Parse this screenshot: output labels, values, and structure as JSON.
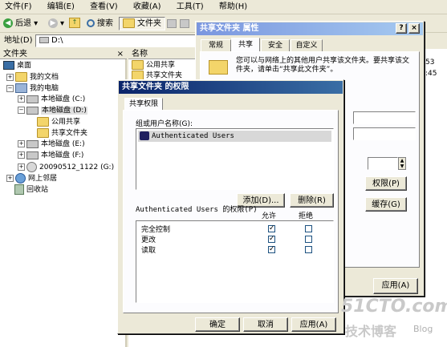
{
  "menu": [
    "文件(F)",
    "编辑(E)",
    "查看(V)",
    "收藏(A)",
    "工具(T)",
    "帮助(H)"
  ],
  "toolbar": {
    "back": "后退",
    "search": "搜索",
    "folders": "文件夹"
  },
  "address": {
    "label": "地址(D)",
    "value": "D:\\"
  },
  "tree": {
    "header": "文件夹",
    "items": [
      "桌面",
      "我的文档",
      "我的电脑",
      "本地磁盘 (C:)",
      "本地磁盘 (D:)",
      "公用共享",
      "共享文件夹",
      "本地磁盘 (E:)",
      "本地磁盘 (F:)",
      "20090512_1122 (G:)",
      "网上邻居",
      "回收站"
    ]
  },
  "list": {
    "column": "名称",
    "items": [
      "公用共享",
      "共享文件夹"
    ],
    "side_text": [
      "53",
      ":45"
    ]
  },
  "props": {
    "title": "共享文件夹 属性",
    "tabs": [
      "常规",
      "共享",
      "安全",
      "自定义"
    ],
    "description": "您可以与网络上的其他用户共享该文件夹。要共享该文件夹，请单击“共享此文件夹”。",
    "permissions_btn": "权限(P)",
    "cache_btn": "缓存(G)",
    "apply_btn": "应用(A)"
  },
  "perm": {
    "title": "共享文件夹 的权限",
    "tab": "共享权限",
    "group_label": "组或用户名称(G):",
    "users": [
      "Authenticated Users"
    ],
    "add_btn": "添加(D)...",
    "remove_btn": "删除(R)",
    "perm_label": "Authenticated Users 的权限(P)",
    "allow_header": "允许",
    "deny_header": "拒绝",
    "rows": [
      {
        "name": "完全控制",
        "allow": "✓",
        "deny": ""
      },
      {
        "name": "更改",
        "allow": "✓",
        "deny": ""
      },
      {
        "name": "读取",
        "allow": "✓",
        "deny": ""
      }
    ],
    "ok_btn": "确定",
    "cancel_btn": "取消",
    "apply_btn": "应用(A)"
  },
  "watermark": {
    "site": "51CTO.com",
    "sub": "技术博客",
    "blog": "Blog"
  },
  "colors": {
    "titlebar_active": "#0a246a",
    "titlebar_inactive": "#7a96df",
    "selection": "#0a246a",
    "watermark": "#c9c9c9"
  }
}
